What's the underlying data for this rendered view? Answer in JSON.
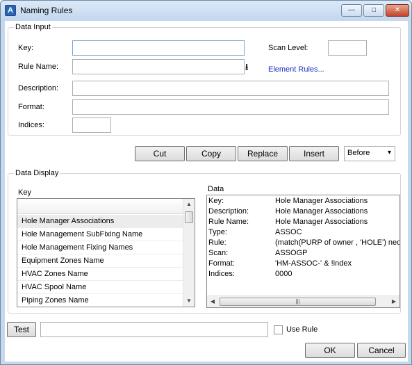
{
  "window": {
    "title": "Naming Rules"
  },
  "titlebar": {
    "minimize": "—",
    "maximize": "□",
    "close": "✕"
  },
  "data_input": {
    "legend": "Data Input",
    "key_label": "Key:",
    "key_value": "",
    "rule_name_label": "Rule Name:",
    "rule_name_value": "",
    "scan_level_label": "Scan Level:",
    "scan_level_value": "",
    "element_rules_link": "Element Rules...",
    "description_label": "Description:",
    "description_value": "",
    "format_label": "Format:",
    "format_value": "",
    "indices_label": "Indices:",
    "indices_value": ""
  },
  "actions": {
    "cut": "Cut",
    "copy": "Copy",
    "replace": "Replace",
    "insert": "Insert",
    "position_selected": "Before"
  },
  "data_display": {
    "legend": "Data Display",
    "key_header": "Key",
    "data_header": "Data",
    "keys": [
      "Hole Manager Associations",
      "Hole Management SubFixing Name",
      "Hole Management Fixing Names",
      "Equipment Zones Name",
      "HVAC Zones Name",
      "HVAC Spool Name",
      "Piping Zones Name"
    ],
    "details": [
      {
        "k": "Key:",
        "v": "Hole Manager Associations"
      },
      {
        "k": "Description:",
        "v": "Hole Manager Associations"
      },
      {
        "k": "Rule Name:",
        "v": "Hole Manager Associations"
      },
      {
        "k": "Type:",
        "v": "ASSOC"
      },
      {
        "k": "Rule:",
        "v": "(match(PURP of owner , 'HOLE') neq"
      },
      {
        "k": "Scan:",
        "v": "ASSOGP"
      },
      {
        "k": "Format:",
        "v": "'HM-ASSOC-' & !index"
      },
      {
        "k": "Indices:",
        "v": "0000"
      }
    ]
  },
  "bottom": {
    "test_button": "Test",
    "test_value": "",
    "use_rule_label": "Use Rule",
    "ok_button": "OK",
    "cancel_button": "Cancel"
  }
}
